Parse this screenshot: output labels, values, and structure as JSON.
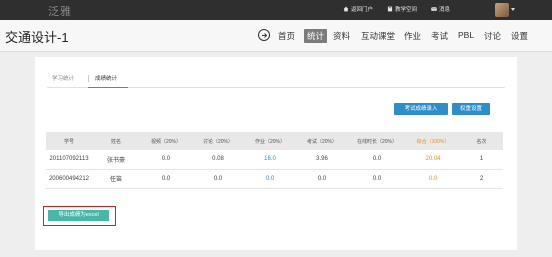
{
  "topbar": {
    "logo": "泛雅",
    "links": [
      {
        "label": "返回门户",
        "icon": "home-icon"
      },
      {
        "label": "教学空间",
        "icon": "book-icon"
      },
      {
        "label": "消息",
        "icon": "mail-icon"
      }
    ]
  },
  "titlebar": {
    "course_title": "交通设计-1",
    "nav": [
      "首页",
      "统计",
      "资料",
      "互动课堂",
      "作业",
      "考试",
      "PBL",
      "讨论",
      "设置"
    ],
    "active_nav": "统计"
  },
  "subtabs": [
    "学习统计",
    "成绩统计"
  ],
  "active_subtab": "成绩统计",
  "buttons": {
    "exam_entry": "考试成绩录入",
    "weight_settings": "权重设置",
    "export": "导出成绩为excel"
  },
  "table": {
    "headers": [
      "学号",
      "姓名",
      "视频（20%）",
      "讨论（20%）",
      "作业（20%）",
      "考试（20%）",
      "在线时长（20%）",
      "综合（100%）",
      "名次"
    ],
    "rows": [
      [
        "201107092113",
        "张书豪",
        "0.0",
        "0.08",
        "16.0",
        "3.96",
        "0.0",
        "20.04",
        "1"
      ],
      [
        "200600494212",
        "任笛",
        "0.0",
        "0.0",
        "0.0",
        "0.0",
        "0.0",
        "0.0",
        "2"
      ]
    ]
  },
  "colors": {
    "accent_blue": "#2d8ec9",
    "total_orange": "#f08c1e",
    "export_green": "#47b8a8",
    "highlight_red": "#d42020"
  }
}
